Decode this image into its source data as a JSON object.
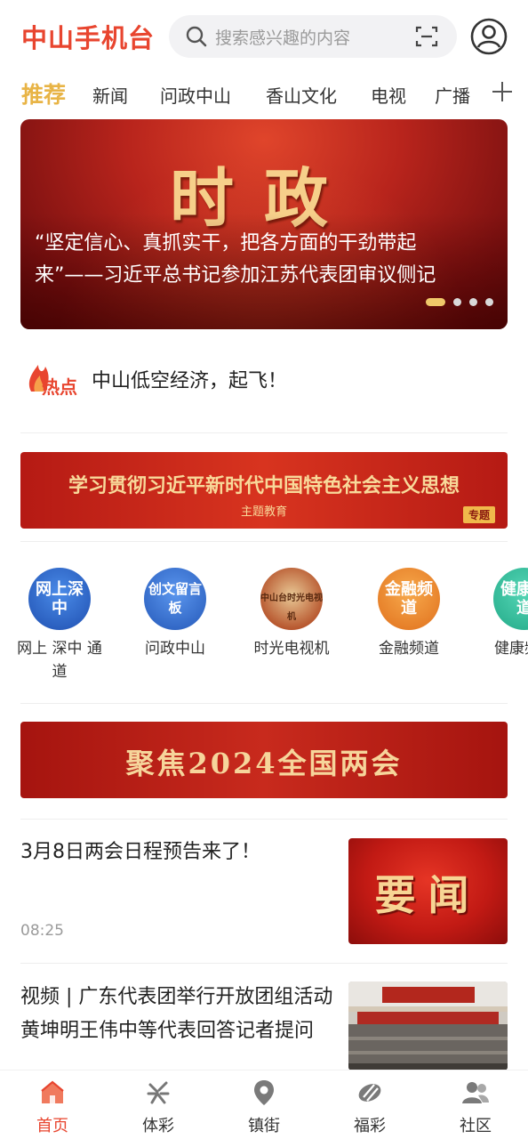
{
  "header": {
    "app_title": "中山手机台",
    "search_placeholder": "搜索感兴趣的内容",
    "icons": [
      "search-icon",
      "scan-icon",
      "user-icon"
    ]
  },
  "tabs": [
    {
      "label": "推荐",
      "active": true
    },
    {
      "label": "新闻",
      "active": false
    },
    {
      "label": "问政中山",
      "active": false
    },
    {
      "label": "香山文化",
      "active": false
    },
    {
      "label": "电视",
      "active": false
    },
    {
      "label": "广播",
      "active": false
    }
  ],
  "hero": {
    "big_text": "时政",
    "caption": "“坚定信心、真抓实干，把各方面的干劲带起来”——习近平总书记参加江苏代表团审议侧记",
    "slide_count": 4,
    "active_slide": 1
  },
  "hot": {
    "badge": "热点",
    "text": "中山低空经济，起飞！"
  },
  "study_banner": {
    "title": "学习贯彻习近平新时代中国特色社会主义思想",
    "subtitle": "主题教育",
    "tag": "专题"
  },
  "channels": [
    {
      "icon_text": "网上深中",
      "label": "网上 深中 通道",
      "color": "#2f6fd6"
    },
    {
      "icon_text": "创文留言板",
      "label": "问政中山",
      "color": "#3a78d8"
    },
    {
      "icon_text": "中山台时光电视机",
      "label": "时光电视机",
      "color": "#b5522a"
    },
    {
      "icon_text": "金融频道",
      "label": "金融频道",
      "color": "#f08a2b"
    },
    {
      "icon_text": "健康频道",
      "label": "健康频",
      "color": "#35c2a3"
    }
  ],
  "focus_banner": {
    "title": "聚焦2024全国两会"
  },
  "news": [
    {
      "title": "3月8日两会日程预告来了！",
      "time": "08:25",
      "thumb_text": "要闻"
    },
    {
      "title": "视频 | 广东代表团举行开放团组活动 黄坤明王伟中等代表回答记者提问"
    }
  ],
  "bottom_nav": [
    {
      "label": "首页",
      "icon": "home-icon",
      "active": true
    },
    {
      "label": "体彩",
      "icon": "sports-lottery-icon",
      "active": false
    },
    {
      "label": "镇街",
      "icon": "location-pin-icon",
      "active": false
    },
    {
      "label": "福彩",
      "icon": "welfare-lottery-icon",
      "active": false
    },
    {
      "label": "社区",
      "icon": "community-icon",
      "active": false
    }
  ],
  "colors": {
    "brand": "#e8452f",
    "active_tab": "#e8b446",
    "banner_red": "#b51a14",
    "gold_text": "#f6cf8a"
  }
}
